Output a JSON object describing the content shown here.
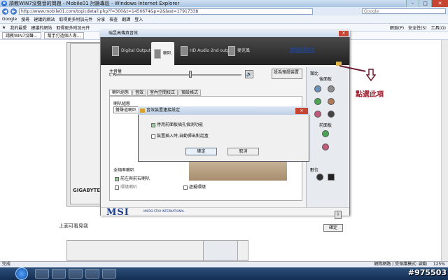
{
  "browser": {
    "title": "請教WIN7沒聲音的問題 - Mobile01 討論專區 - Windows Internet Explorer",
    "url": "http://www.mobile01.com/topicdetail.php?f=300&t=1450674&p=2&last=17917338",
    "search_placeholder": "Google",
    "toolbar_items": [
      "Google",
      "搜尋",
      "建議的網站",
      "取得更多附加元件",
      "分享",
      "檢查",
      "翻譯",
      "登入"
    ],
    "fav_items": [
      "我的最愛",
      "建議的網站",
      "取得更多附加元件",
      "網頁(P)",
      "安全性(S)",
      "工具(O)"
    ],
    "tabs": [
      "請教WIN7沒聲...",
      "幫手打造個人專..."
    ],
    "status_left": "完成",
    "status_right": "網際網路 | 受保護模式: 啟動",
    "zoom": "125%",
    "watermark": "#975503"
  },
  "dialog": {
    "title": "瑞昱高傳真音效",
    "tabs": [
      "Digital Output",
      "喇叭",
      "HD Audio 2nd output",
      "麥克風"
    ],
    "advanced_link": "進階裝置設定",
    "main_volume": "主音量",
    "lr": "L          R",
    "default_device": "設為預設裝置",
    "subtabs": [
      "喇叭組態",
      "音效",
      "室內空間校正",
      "預設格式"
    ],
    "config_label": "喇叭組態",
    "config_value": "雙聲道喇叭",
    "full_range": "全頻率喇叭",
    "chk_front": "前左與前右喇叭",
    "chk_surround": "環繞喇叭",
    "chk_virtual": "虛擬環繞",
    "jack_label": "類比",
    "rear_panel": "後面板",
    "front_panel": "前面板",
    "digital_label": "數位",
    "ok": "確定",
    "logo": "MSI",
    "logo_sub": "MICRO-STAR INTERNATIONAL"
  },
  "modal": {
    "title": "音效裝置連接設定",
    "opt1": "停用前面板插孔偵測功能",
    "opt2": "裝置插入時,自動彈出對話盒",
    "ok": "確定",
    "cancel": "取消"
  },
  "annotation": {
    "text": "點選此項"
  },
  "page": {
    "text": "上面可看見我",
    "gigabyte": "GIGABYTE"
  }
}
